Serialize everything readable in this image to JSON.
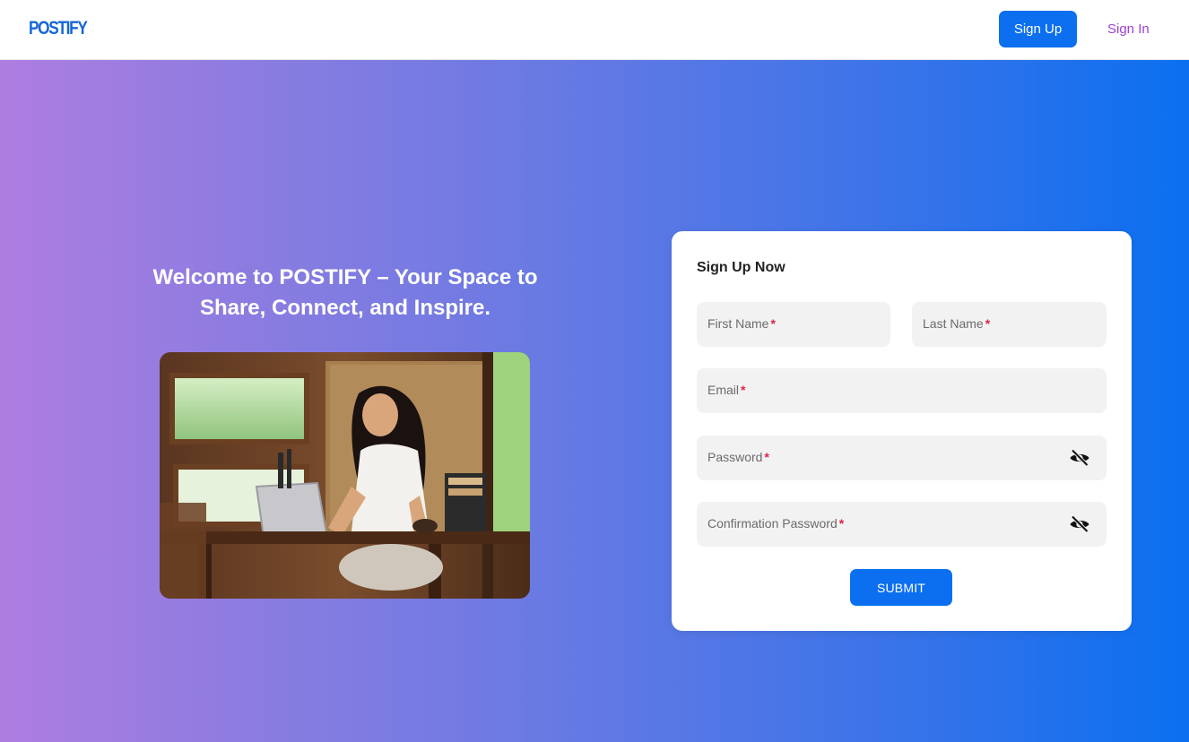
{
  "header": {
    "logo": "POSTIFY",
    "signup_label": "Sign Up",
    "signin_label": "Sign In"
  },
  "hero": {
    "headline_line1": "Welcome to POSTIFY – Your Space to",
    "headline_line2": "Share, Connect, and Inspire."
  },
  "form": {
    "title": "Sign Up Now",
    "fields": {
      "first_name": {
        "label": "First Name",
        "required_mark": "*",
        "value": ""
      },
      "last_name": {
        "label": "Last Name",
        "required_mark": "*",
        "value": ""
      },
      "email": {
        "label": "Email",
        "required_mark": "*",
        "value": ""
      },
      "password": {
        "label": "Password",
        "required_mark": "*",
        "value": "",
        "icon": "eye-slash-icon"
      },
      "confirm_password": {
        "label": "Confirmation Password",
        "required_mark": "*",
        "value": "",
        "icon": "eye-slash-icon"
      }
    },
    "submit_label": "SUBMIT"
  },
  "colors": {
    "accent": "#0b6ff0",
    "signin_link": "#9b3fd6",
    "required": "#e0214b",
    "gradient_start": "#ae7de0",
    "gradient_end": "#0b6ff0"
  }
}
